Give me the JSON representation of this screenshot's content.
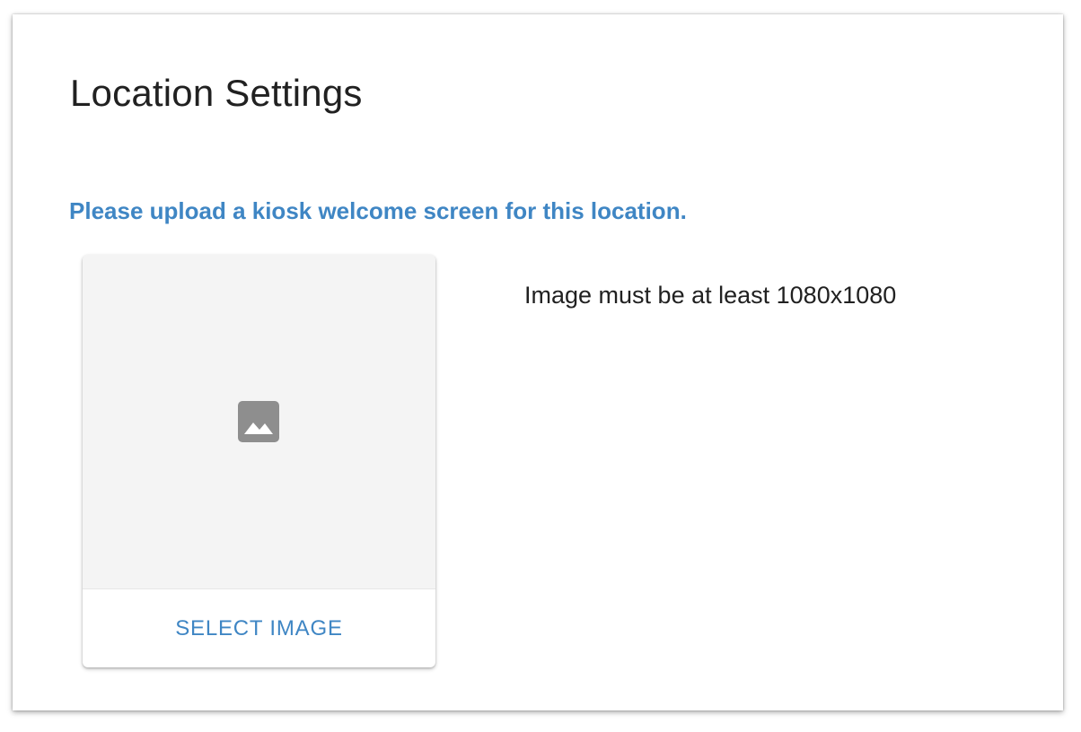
{
  "page": {
    "title": "Location Settings",
    "instruction": "Please upload a kiosk welcome screen for this location.",
    "requirement": "Image must be at least 1080x1080"
  },
  "image_card": {
    "icon": "image-placeholder-icon",
    "select_label": "SELECT IMAGE"
  },
  "colors": {
    "accent": "#3f86c4",
    "text": "#212121",
    "preview_background": "#f4f4f4",
    "icon": "#8e8e8e"
  }
}
